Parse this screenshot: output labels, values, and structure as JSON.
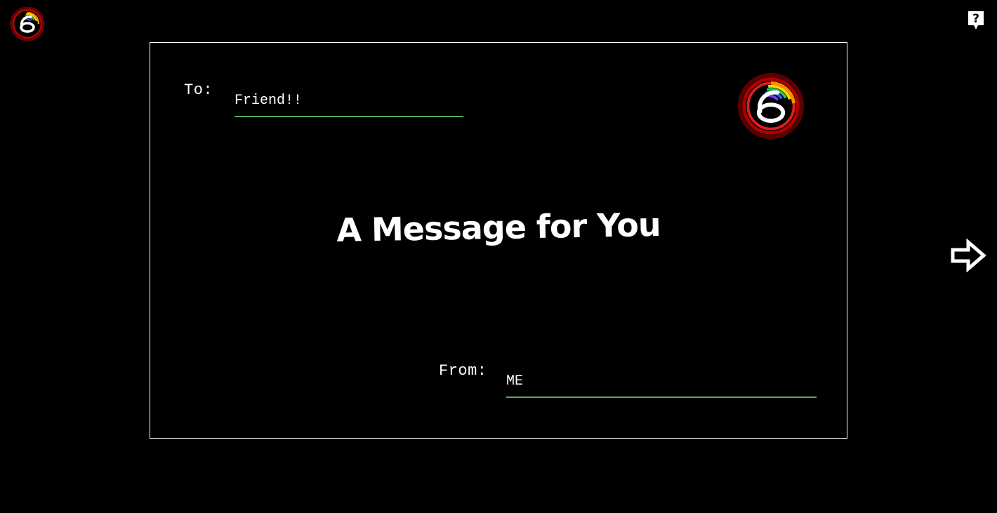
{
  "app_logo": {
    "icon": "rainbow-six-logo-icon"
  },
  "help": {
    "icon": "help-icon"
  },
  "card": {
    "to_label": "To:",
    "to_value": "Friend!!",
    "from_label": "From:",
    "from_value": "ME",
    "title": "A Message for You",
    "logo_icon": "rainbow-six-logo-icon"
  },
  "navigation": {
    "next_icon": "arrow-right-icon"
  },
  "colors": {
    "background": "#000000",
    "text": "#ffffff",
    "card_border": "#ffffff",
    "input_underline": "#4caf50"
  }
}
